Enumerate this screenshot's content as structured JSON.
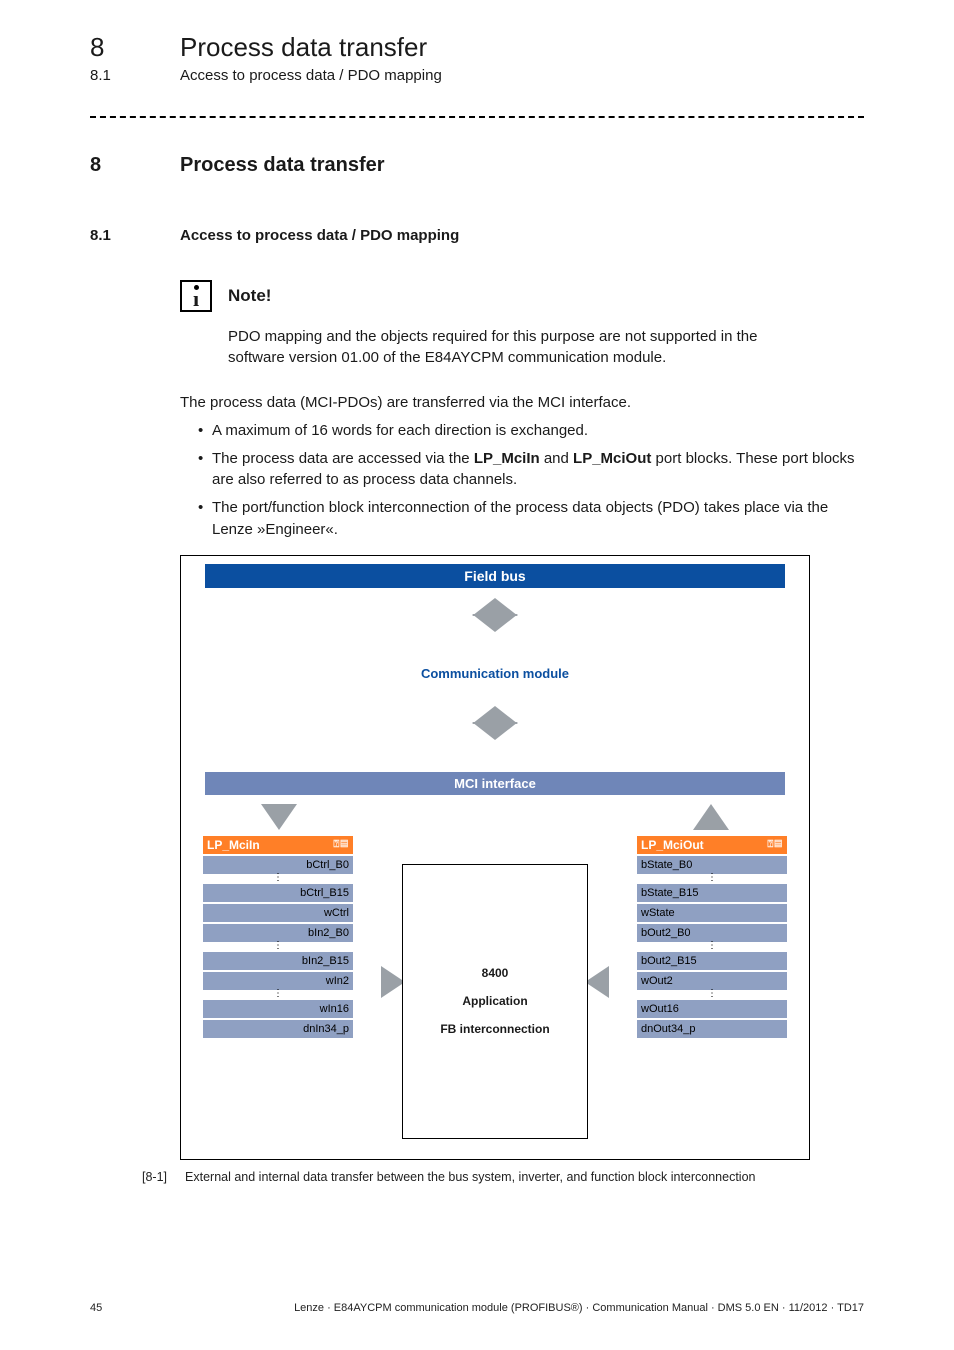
{
  "header": {
    "chapter_number": "8",
    "chapter_title": "Process data transfer",
    "section_number": "8.1",
    "section_title": "Access to process data / PDO mapping"
  },
  "section": {
    "num": "8",
    "title": "Process data transfer",
    "sub_num": "8.1",
    "sub_title": "Access to process data / PDO mapping"
  },
  "note": {
    "label": "Note!",
    "body": "PDO mapping and the objects required for this purpose are not supported in the software version 01.00 of the E84AYCPM communication module."
  },
  "paragraph": "The process data (MCI-PDOs) are transferred via the MCI interface.",
  "bullets": [
    "A maximum of 16 words for each direction is exchanged.",
    "The process data are accessed via the LP_MciIn and LP_MciOut port blocks. These port blocks are also referred to as process data channels.",
    "The port/function block interconnection of the process data objects (PDO) takes place via the Lenze »Engineer«."
  ],
  "bullet_plain_1": "The process data are accessed via the ",
  "bullet_bold_a": "LP_MciIn",
  "bullet_mid": " and ",
  "bullet_bold_b": "LP_MciOut",
  "bullet_plain_2": " port blocks. These port blocks are also referred to as process data channels.",
  "diagram": {
    "fieldbus": "Field bus",
    "comm_module": "Communication module",
    "mci": "MCI interface",
    "center": {
      "l1": "8400",
      "l2": "Application",
      "l3": "FB interconnection"
    },
    "left_block": {
      "title": "LP_MciIn",
      "rows": [
        "bCtrl_B0",
        "bCtrl_B15",
        "wCtrl",
        "bIn2_B0",
        "bIn2_B15",
        "wIn2",
        "wIn16",
        "dnIn34_p"
      ]
    },
    "right_block": {
      "title": "LP_MciOut",
      "rows": [
        "bState_B0",
        "bState_B15",
        "wState",
        "bOut2_B0",
        "bOut2_B15",
        "wOut2",
        "wOut16",
        "dnOut34_p"
      ]
    },
    "mini_icons": "⍰▤"
  },
  "caption": {
    "tag": "[8-1]",
    "text": "External and internal data transfer between the bus system, inverter, and function block interconnection"
  },
  "footer": {
    "page": "45",
    "text": "Lenze · E84AYCPM communication module (PROFIBUS®) · Communication Manual · DMS 5.0 EN · 11/2012 · TD17"
  }
}
